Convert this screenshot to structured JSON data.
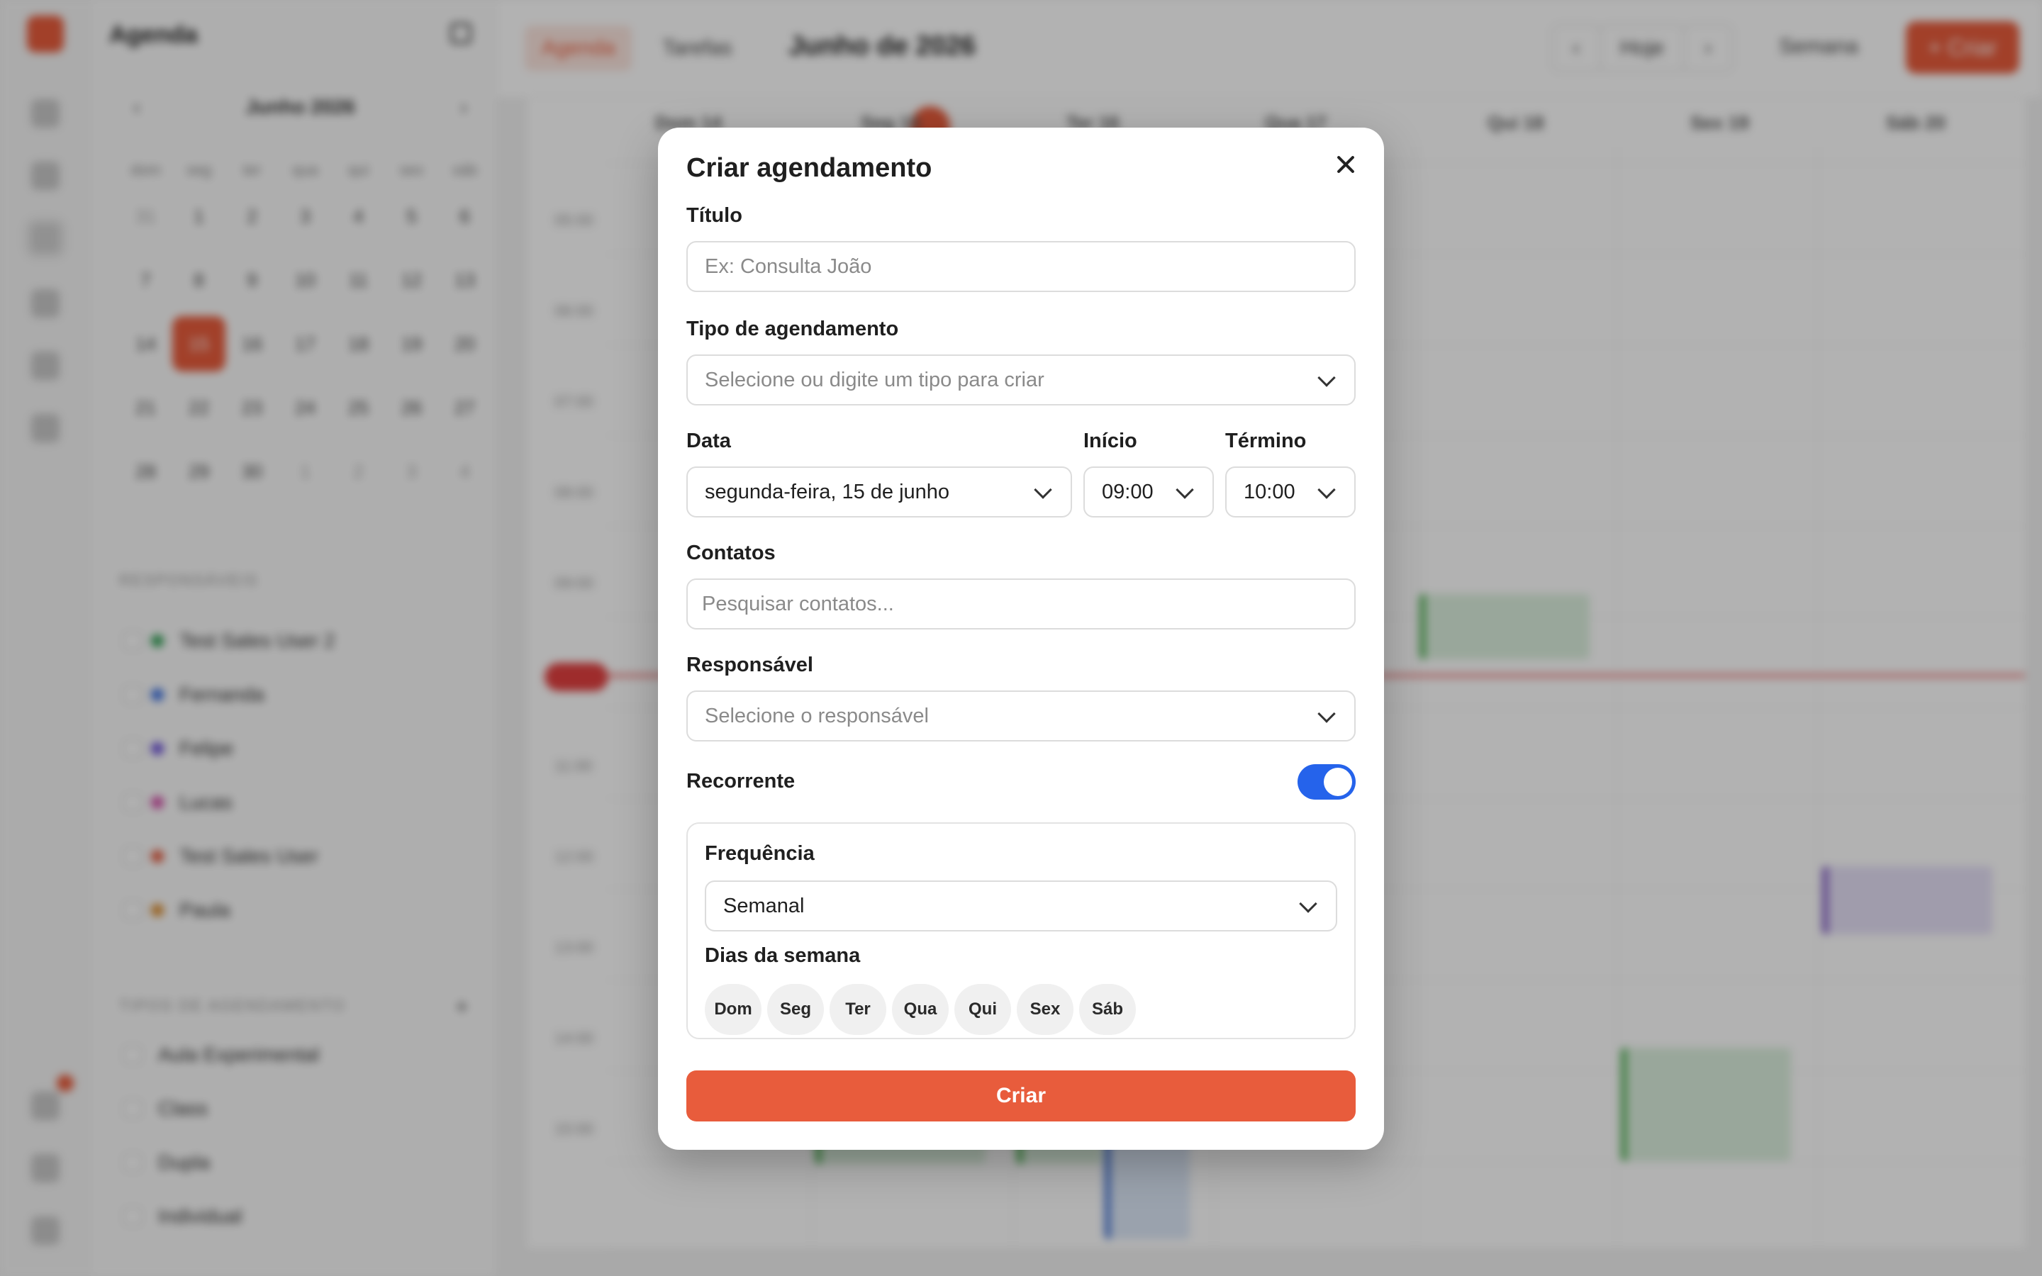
{
  "background": {
    "sidebar": {
      "title": "Agenda",
      "mini_calendar": {
        "month": "Junho 2026",
        "weekdays": [
          "dom",
          "seg",
          "ter",
          "qua",
          "qui",
          "sex",
          "sáb"
        ],
        "days": [
          "31",
          "1",
          "2",
          "3",
          "4",
          "5",
          "6",
          "7",
          "8",
          "9",
          "10",
          "11",
          "12",
          "13",
          "14",
          "15",
          "16",
          "17",
          "18",
          "19",
          "20",
          "21",
          "22",
          "23",
          "24",
          "25",
          "26",
          "27",
          "28",
          "29",
          "30",
          "1",
          "2",
          "3",
          "4"
        ]
      },
      "responsaveis_label": "RESPONSÁVEIS",
      "responsaveis": [
        {
          "name": "Test Sales User 2",
          "color": "#2e9e52"
        },
        {
          "name": "Fernanda",
          "color": "#3a6fe0"
        },
        {
          "name": "Felipe",
          "color": "#6a4fd8"
        },
        {
          "name": "Lucas",
          "color": "#d14aa6"
        },
        {
          "name": "Test Sales User",
          "color": "#e2583c"
        },
        {
          "name": "Paula",
          "color": "#d98a2b"
        }
      ],
      "tipos_label": "TIPOS DE AGENDAMENTO",
      "tipos": [
        "Aula Experimental",
        "Class",
        "Dupla",
        "Individual"
      ]
    },
    "topbar": {
      "tab_agenda": "Agenda",
      "tab_tarefas": "Tarefas",
      "title": "Junho de 2026",
      "today_button": "Hoje",
      "view_select": "Semana",
      "create_button": "+ Criar"
    },
    "calendar": {
      "day_headers": [
        "Dom 14",
        "Seg 15",
        "Ter 16",
        "Qua 17",
        "Qui 18",
        "Sex 19",
        "Sáb 20"
      ],
      "hours": [
        "05:00",
        "06:00",
        "07:00",
        "08:00",
        "09:00",
        "10:00",
        "11:00",
        "12:00",
        "13:00",
        "14:00",
        "15:00"
      ]
    }
  },
  "modal": {
    "title": "Criar agendamento",
    "titulo_label": "Título",
    "titulo_placeholder": "Ex: Consulta João",
    "tipo_label": "Tipo de agendamento",
    "tipo_placeholder": "Selecione ou digite um tipo para criar",
    "data_label": "Data",
    "data_value": "segunda-feira, 15 de junho",
    "inicio_label": "Início",
    "inicio_value": "09:00",
    "termino_label": "Término",
    "termino_value": "10:00",
    "contatos_label": "Contatos",
    "contatos_placeholder": "Pesquisar contatos...",
    "responsavel_label": "Responsável",
    "responsavel_placeholder": "Selecione o responsável",
    "recorrente_label": "Recorrente",
    "recorrente_on": true,
    "frequencia_label": "Frequência",
    "frequencia_value": "Semanal",
    "dias_label": "Dias da semana",
    "dias": [
      "Dom",
      "Seg",
      "Ter",
      "Qua",
      "Qui",
      "Sex",
      "Sáb"
    ],
    "submit_label": "Criar"
  },
  "colors": {
    "accent": "#e85c3c",
    "toggle_on": "#2563eb"
  }
}
